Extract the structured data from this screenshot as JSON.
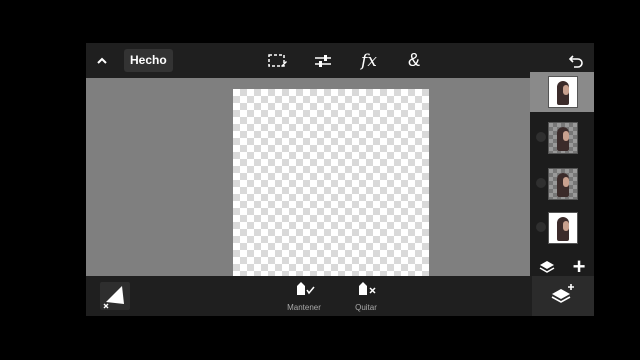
{
  "toolbar": {
    "done_label": "Hecho",
    "collapse_icon": "chevron-up-icon",
    "tools": [
      "selection-icon",
      "adjust-icon",
      "fx-icon",
      "blend-icon"
    ],
    "fx_label": "fx",
    "amp_label": "&",
    "undo_icon": "undo-icon"
  },
  "layers": {
    "items": [
      {
        "thumbnail": "portrait",
        "active": true
      },
      {
        "thumbnail": "portrait-transparent",
        "active": false
      },
      {
        "thumbnail": "portrait-transparent",
        "active": false
      },
      {
        "thumbnail": "portrait",
        "active": false
      }
    ],
    "add_label": "+"
  },
  "bottom": {
    "keep_label": "Mantener",
    "remove_label": "Quitar"
  },
  "colors": {
    "toolbar_bg": "#1f1f1f",
    "workspace_bg": "#7f7f7f",
    "panel_bg": "#1c1c1c"
  }
}
